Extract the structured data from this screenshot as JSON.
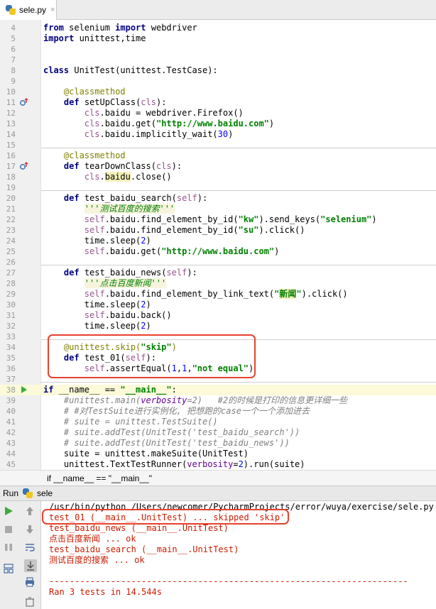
{
  "tab": {
    "filename": "sele.py",
    "close": "×"
  },
  "lines": [
    {
      "n": "4",
      "html": "<span class=\"kw\">from</span> selenium <span class=\"kw\">import</span> webdriver"
    },
    {
      "n": "5",
      "html": "<span class=\"kw\">import</span> unittest,time"
    },
    {
      "n": "6",
      "html": ""
    },
    {
      "n": "7",
      "html": ""
    },
    {
      "n": "8",
      "html": "<span class=\"kw\">class</span> UnitTest(unittest.TestCase):"
    },
    {
      "n": "9",
      "html": ""
    },
    {
      "n": "10",
      "html": "    <span class=\"dec\">@classmethod</span>"
    },
    {
      "n": "11",
      "html": "    <span class=\"kw\">def</span> setUpClass(<span class=\"self\">cls</span>):"
    },
    {
      "n": "12",
      "html": "        <span class=\"self\">cls</span>.baidu = webdriver.Firefox()"
    },
    {
      "n": "13",
      "html": "        <span class=\"self\">cls</span>.baidu.get(<span class=\"str\">\"http://www.baidu.com\"</span>)"
    },
    {
      "n": "14",
      "html": "        <span class=\"self\">cls</span>.baidu.implicitly_wait(<span class=\"num\">30</span>)"
    },
    {
      "n": "15",
      "html": ""
    },
    {
      "n": "16",
      "html": "    <span class=\"dec\">@classmethod</span>"
    },
    {
      "n": "17",
      "html": "    <span class=\"kw\">def</span> tearDownClass(<span class=\"self\">cls</span>):"
    },
    {
      "n": "18",
      "html": "        <span class=\"self\">cls</span>.<span class=\"hl\">baidu</span>.close()"
    },
    {
      "n": "19",
      "html": ""
    },
    {
      "n": "20",
      "html": "    <span class=\"kw\">def</span> test_baidu_search(<span class=\"self\">self</span>):"
    },
    {
      "n": "21",
      "html": "        <span class=\"doc\">'''测试百度的搜索'''</span>"
    },
    {
      "n": "22",
      "html": "        <span class=\"self\">self</span>.baidu.find_element_by_id(<span class=\"str\">\"kw\"</span>).send_keys(<span class=\"str\">\"selenium\"</span>)"
    },
    {
      "n": "23",
      "html": "        <span class=\"self\">self</span>.baidu.find_element_by_id(<span class=\"str\">\"su\"</span>).click()"
    },
    {
      "n": "24",
      "html": "        time.sleep(<span class=\"num\">2</span>)"
    },
    {
      "n": "25",
      "html": "        <span class=\"self\">self</span>.baidu.get(<span class=\"str\">\"http://www.baidu.com\"</span>)"
    },
    {
      "n": "26",
      "html": ""
    },
    {
      "n": "27",
      "html": "    <span class=\"kw\">def</span> test_baidu_news(<span class=\"self\">self</span>):"
    },
    {
      "n": "28",
      "html": "        <span class=\"doc\">'''点击百度新闻'''</span>"
    },
    {
      "n": "29",
      "html": "        <span class=\"self\">self</span>.baidu.find_element_by_link_text(<span class=\"str\">\"<span class=\"hl\">新闻</span>\"</span>).click()"
    },
    {
      "n": "30",
      "html": "        time.sleep(<span class=\"num\">2</span>)"
    },
    {
      "n": "31",
      "html": "        <span class=\"self\">self</span>.baidu.back()"
    },
    {
      "n": "32",
      "html": "        time.sleep(<span class=\"num\">2</span>)"
    },
    {
      "n": "33",
      "html": ""
    },
    {
      "n": "34",
      "html": "    <span class=\"dec\">@unittest.skip(</span><span class=\"str\">\"skip\"</span><span class=\"dec\">)</span>"
    },
    {
      "n": "35",
      "html": "    <span class=\"kw\">def</span> test_01(<span class=\"self\">self</span>):"
    },
    {
      "n": "36",
      "html": "        <span class=\"self\">self</span>.assertEqual(<span class=\"num\">1</span>,<span class=\"num\">1</span>,<span class=\"str\">\"not equal\"</span>)"
    },
    {
      "n": "37",
      "html": ""
    },
    {
      "n": "38",
      "html": "<span class=\"kw\">if</span> __name__ == <span class=\"str\">\"__main__\"</span>:"
    },
    {
      "n": "39",
      "html": "    <span class=\"cm\">#unittest.main(<span class=\"prm\">verbosity</span>=2)   #2的时候是打印的信息更详细一些</span>"
    },
    {
      "n": "40",
      "html": "    <span class=\"cm\"># #对TestSuite进行实例化, 把想跑的case一个一个添加进去</span>"
    },
    {
      "n": "41",
      "html": "    <span class=\"cm\"># suite = unittest.TestSuite()</span>"
    },
    {
      "n": "42",
      "html": "    <span class=\"cm\"># suite.addTest(UnitTest('test_baidu_search'))</span>"
    },
    {
      "n": "43",
      "html": "    <span class=\"cm\"># suite.addTest(UnitTest('test_baidu_news'))</span>"
    },
    {
      "n": "44",
      "html": "    suite = unittest.makeSuite(UnitTest)"
    },
    {
      "n": "45",
      "html": "    unittest.TextTestRunner(<span class=\"prm\">verbosity</span>=<span class=\"num\">2</span>).run(suite)"
    }
  ],
  "breadcrumb": "if __name__ == \"__main__\"",
  "run_panel": {
    "label": "Run",
    "config": "sele",
    "output": [
      {
        "text": "/usr/bin/python /Users/newcomer/PycharmProjects/error/wuya/exercise/sele.py",
        "style": "black"
      },
      {
        "text": "test_01 (__main__.UnitTest) ... skipped 'skip'",
        "style": "red"
      },
      {
        "text": "test_baidu_news (__main__.UnitTest)",
        "style": "red"
      },
      {
        "text": "点击百度新闻 ... ok",
        "style": "red"
      },
      {
        "text": "test_baidu_search (__main__.UnitTest)",
        "style": "red"
      },
      {
        "text": "测试百度的搜索 ... ok",
        "style": "red"
      },
      {
        "text": "",
        "style": "red"
      },
      {
        "text": "----------------------------------------------------------------------",
        "style": "red"
      },
      {
        "text": "Ran 3 tests in 14.544s",
        "style": "red"
      }
    ]
  },
  "colors": {
    "highlight_box": "#e8412c",
    "run_green": "#3daa3b",
    "stderr_red": "#c91b00"
  }
}
